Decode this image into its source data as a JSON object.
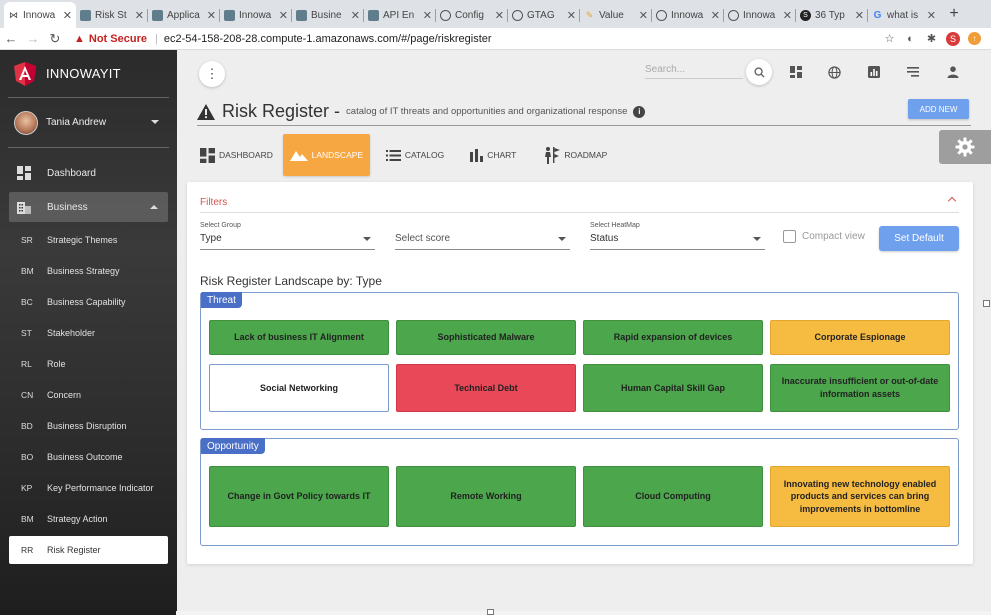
{
  "browser": {
    "tabs": [
      {
        "label": "Innowa",
        "icon": "innowayit-favicon",
        "active": true
      },
      {
        "label": "Risk St",
        "icon": "app-favicon"
      },
      {
        "label": "Applica",
        "icon": "app-favicon"
      },
      {
        "label": "Innowa",
        "icon": "app-favicon"
      },
      {
        "label": "Busine",
        "icon": "app-favicon"
      },
      {
        "label": "API En",
        "icon": "app-favicon"
      },
      {
        "label": "Config",
        "icon": "github-favicon"
      },
      {
        "label": "GTAG",
        "icon": "github-favicon"
      },
      {
        "label": "Value",
        "icon": "pen-favicon"
      },
      {
        "label": "Innowa",
        "icon": "github-favicon"
      },
      {
        "label": "Innowa",
        "icon": "github-favicon"
      },
      {
        "label": "36 Typ",
        "icon": "s-favicon"
      },
      {
        "label": "what is",
        "icon": "google-favicon"
      }
    ],
    "new_tab": "+",
    "not_secure": "Not Secure",
    "url": "ec2-54-158-208-28.compute-1.amazonaws.com/#/page/riskregister",
    "profile_initial": "S"
  },
  "sidebar": {
    "brand": "INNOWAYIT",
    "user_name": "Tania Andrew",
    "items": [
      {
        "label": "Dashboard",
        "icon": "dashboard-icon"
      },
      {
        "label": "Business",
        "icon": "building-icon"
      }
    ],
    "sub_items": [
      {
        "abbr": "SR",
        "label": "Strategic Themes"
      },
      {
        "abbr": "BM",
        "label": "Business Strategy"
      },
      {
        "abbr": "BC",
        "label": "Business Capability"
      },
      {
        "abbr": "ST",
        "label": "Stakeholder"
      },
      {
        "abbr": "RL",
        "label": "Role"
      },
      {
        "abbr": "CN",
        "label": "Concern"
      },
      {
        "abbr": "BD",
        "label": "Business Disruption"
      },
      {
        "abbr": "BO",
        "label": "Business Outcome"
      },
      {
        "abbr": "KP",
        "label": "Key Performance Indicator"
      },
      {
        "abbr": "BM",
        "label": "Strategy Action"
      },
      {
        "abbr": "RR",
        "label": "Risk Register",
        "active": true
      }
    ]
  },
  "topnav": {
    "search_placeholder": "Search..."
  },
  "page": {
    "title": "Risk Register",
    "dash": "-",
    "subtitle": "catalog of IT threats and opportunities and organizational response",
    "add_new": "ADD NEW"
  },
  "view_tabs": [
    {
      "label": "DASHBOARD",
      "icon": "dashboard-icon"
    },
    {
      "label": "LANDSCAPE",
      "icon": "landscape-icon",
      "active": true
    },
    {
      "label": "CATALOG",
      "icon": "list-icon"
    },
    {
      "label": "CHART",
      "icon": "bar-chart-icon"
    },
    {
      "label": "ROADMAP",
      "icon": "roadmap-icon"
    }
  ],
  "filters": {
    "title": "Filters",
    "group": {
      "label": "Select Group",
      "value": "Type"
    },
    "score": {
      "label": "",
      "value": "Select score"
    },
    "heatmap": {
      "label": "Select HeatMap",
      "value": "Status"
    },
    "compact_view": "Compact view",
    "set_default": "Set Default"
  },
  "landscape": {
    "title": "Risk Register Landscape by: Type",
    "groups": [
      {
        "name": "Threat",
        "tiles": [
          {
            "label": "Lack of business IT Alignment",
            "color": "#4ca64c"
          },
          {
            "label": "Sophisticated Malware",
            "color": "#4ca64c"
          },
          {
            "label": "Rapid expansion of devices",
            "color": "#4ca64c"
          },
          {
            "label": "Corporate Espionage",
            "color": "#f6bc42"
          },
          {
            "label": "Social Networking",
            "color": "#ffffff"
          },
          {
            "label": "Technical Debt",
            "color": "#e84858"
          },
          {
            "label": "Human Capital Skill Gap",
            "color": "#4ca64c"
          },
          {
            "label": "Inaccurate insufficient or out-of-date information assets",
            "color": "#4ca64c"
          }
        ]
      },
      {
        "name": "Opportunity",
        "tiles": [
          {
            "label": "Change in Govt Policy towards IT",
            "color": "#4ca64c"
          },
          {
            "label": "Remote Working",
            "color": "#4ca64c"
          },
          {
            "label": "Cloud Computing",
            "color": "#4ca64c"
          },
          {
            "label": "Innovating new technology enabled products and services can bring improvements in bottomline",
            "color": "#f6bc42"
          }
        ]
      }
    ]
  }
}
